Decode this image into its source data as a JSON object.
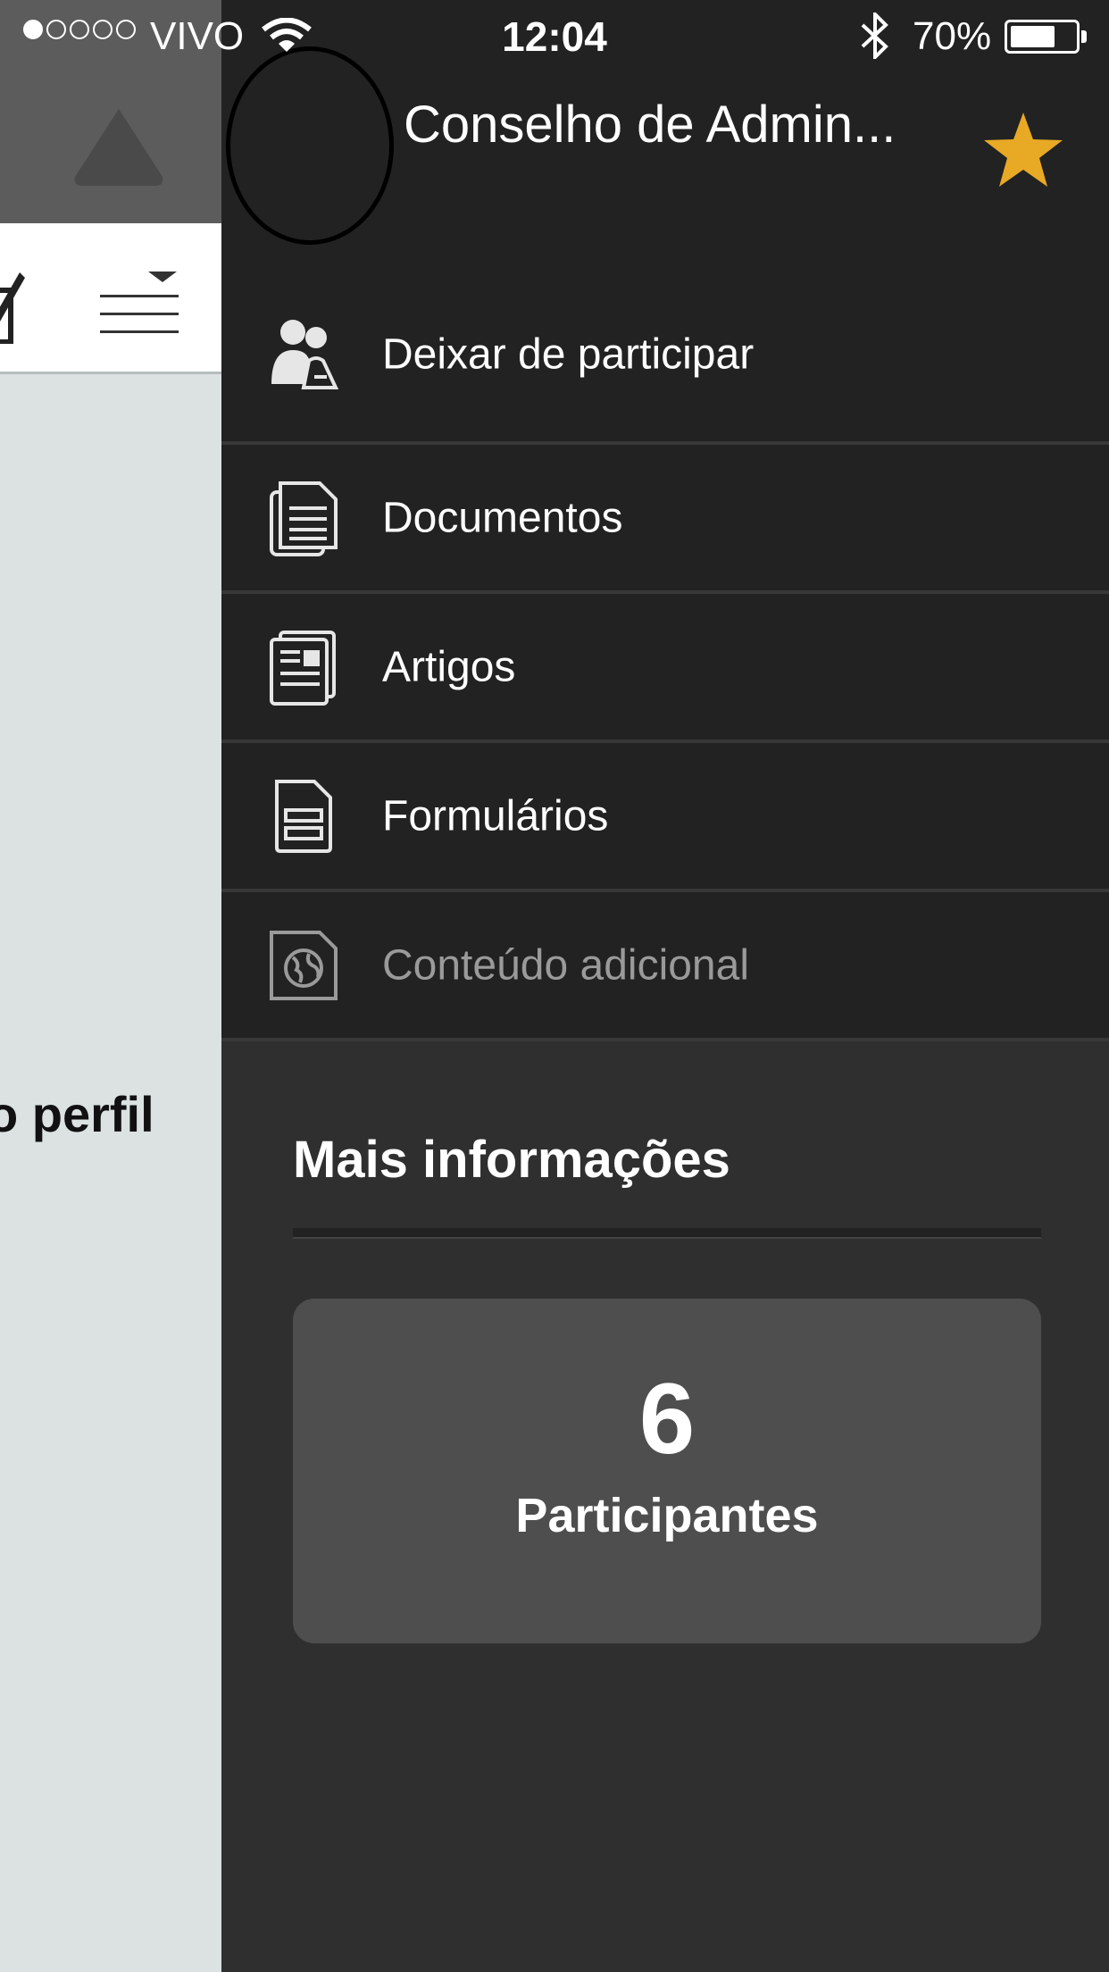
{
  "status_bar": {
    "signal_filled": 1,
    "signal_total": 5,
    "carrier": "VIVO",
    "time": "12:04",
    "battery_percent_label": "70%",
    "battery_level": 0.7
  },
  "background_app": {
    "profile_text_fragment": "o perfil"
  },
  "drawer": {
    "group_title": "Conselho de Admin...",
    "favorite_color": "#e8a924",
    "menu": [
      {
        "label": "Deixar de participar",
        "icon": "leave-group-icon"
      },
      {
        "label": "Documentos",
        "icon": "documents-icon"
      },
      {
        "label": "Artigos",
        "icon": "articles-icon"
      },
      {
        "label": "Formulários",
        "icon": "forms-icon"
      },
      {
        "label": "Conteúdo adicional",
        "icon": "globe-document-icon",
        "disabled": true
      }
    ],
    "more_info": {
      "title": "Mais informações",
      "participants_count": "6",
      "participants_label": "Participantes"
    }
  }
}
